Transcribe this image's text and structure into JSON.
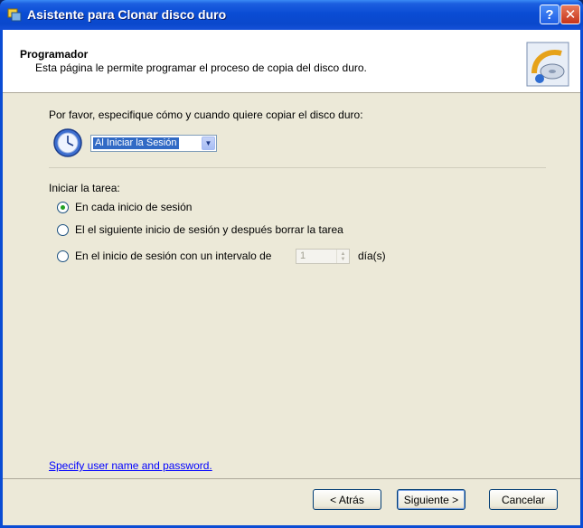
{
  "window": {
    "title": "Asistente para Clonar disco duro",
    "help_label": "?",
    "close_label": "✕",
    "title_icon": "wizard-icon"
  },
  "header": {
    "title": "Programador",
    "subtitle": "Esta página le permite programar el proceso de copia del disco duro.",
    "graphic": "disk-copy-icon"
  },
  "schedule": {
    "prompt": "Por favor, especifique cómo y cuando quiere copiar el disco duro:",
    "selected": "Al Iniciar la Sesión",
    "icon": "clock-icon"
  },
  "task": {
    "label": "Iniciar la tarea:",
    "options": [
      {
        "label": "En cada inicio de sesión",
        "checked": true
      },
      {
        "label": "El el siguiente inicio de sesión y después borrar la tarea",
        "checked": false
      },
      {
        "label": "En el inicio de sesión con un intervalo de",
        "checked": false
      }
    ],
    "interval_value": "1",
    "interval_unit": "día(s)"
  },
  "link": {
    "label": "Specify user name and password."
  },
  "buttons": {
    "back": "< Atrás",
    "next": "Siguiente >",
    "cancel": "Cancelar"
  }
}
